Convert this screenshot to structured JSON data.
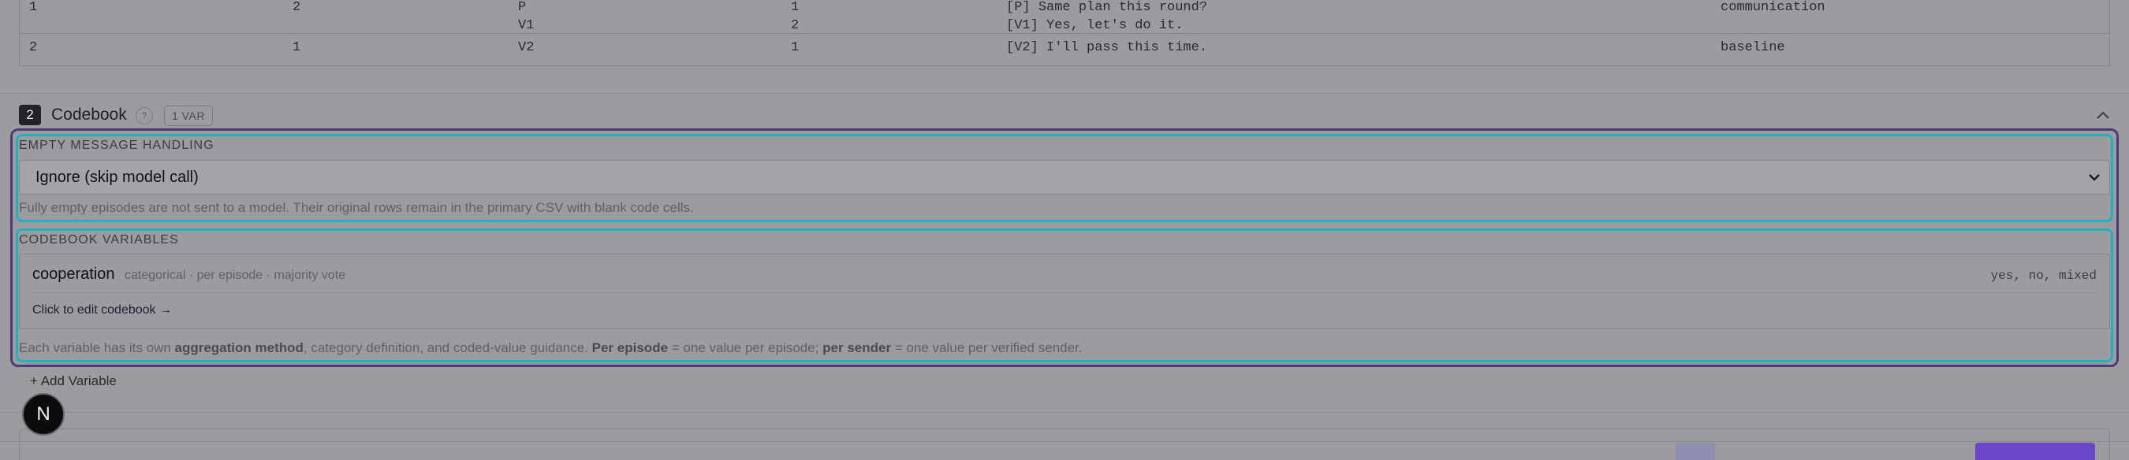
{
  "episodes_table": {
    "rows": [
      {
        "c1": "1",
        "c2": "2",
        "c3": [
          "P",
          "V1"
        ],
        "c4": [
          "1",
          "2"
        ],
        "c5": [
          "[P] Same plan this round?",
          "[V1] Yes, let's do it."
        ],
        "c6": "communication"
      },
      {
        "c1": "2",
        "c2": "1",
        "c3": [
          "V2"
        ],
        "c4": [
          "1"
        ],
        "c5": [
          "[V2] I'll pass this time."
        ],
        "c6": "baseline"
      }
    ]
  },
  "codebook": {
    "number": "2",
    "title": "Codebook",
    "help": "?",
    "badge": "1 VAR",
    "collapse_icon": "chevron-up-icon"
  },
  "empty_message": {
    "label": "EMPTY MESSAGE HANDLING",
    "selected": "Ignore (skip model call)",
    "help": "Fully empty episodes are not sent to a model. Their original rows remain in the primary CSV with blank code cells."
  },
  "variables": {
    "label": "CODEBOOK VARIABLES",
    "items": [
      {
        "name": "cooperation",
        "meta": "categorical · per episode · majority vote",
        "values": "yes, no, mixed",
        "edit": "Click to edit codebook →"
      }
    ],
    "help": {
      "p1": "Each variable has its own ",
      "b1": "aggregation method",
      "p2": ", category definition, and coded-value guidance. ",
      "b2": "Per episode",
      "p3": " = one value per episode; ",
      "b3": "per sender",
      "p4": " = one value per verified sender."
    },
    "add_label": "+ Add Variable"
  },
  "avatar_initial": "N",
  "colors": {
    "overlay": "#9b9ba0",
    "highlight_cyan": "#1fb3bf",
    "highlight_purple": "#4c3b76",
    "bottom_button_purple": "#6c46c8"
  }
}
